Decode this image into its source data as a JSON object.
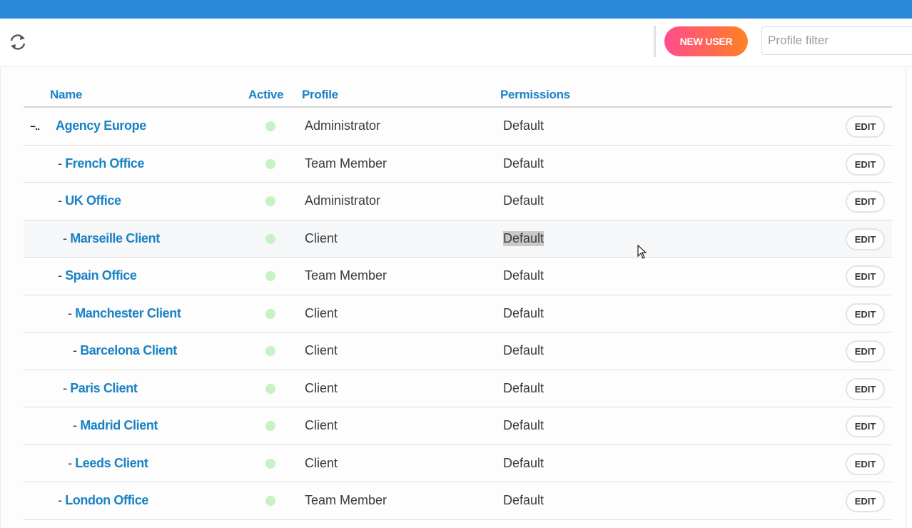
{
  "toolbar": {
    "refresh_icon": "refresh-icon",
    "new_user_label": "NEW USER",
    "filter_placeholder": "Profile filter",
    "filter_value": ""
  },
  "table": {
    "headers": {
      "name": "Name",
      "active": "Active",
      "profile": "Profile",
      "permissions": "Permissions"
    },
    "edit_label": "EDIT",
    "rows": [
      {
        "prefix": "",
        "name": "Agency Europe",
        "profile": "Administrator",
        "permissions": "Default",
        "active": true,
        "collapse": "−.."
      },
      {
        "prefix": "- ",
        "name": "French Office",
        "profile": "Team Member",
        "permissions": "Default",
        "active": true
      },
      {
        "prefix": "- ",
        "name": "UK Office",
        "profile": "Administrator",
        "permissions": "Default",
        "active": true
      },
      {
        "prefix": "- ",
        "name": "Marseille Client",
        "profile": "Client",
        "permissions": "Default",
        "active": true
      },
      {
        "prefix": "- ",
        "name": "Spain Office",
        "profile": "Team Member",
        "permissions": "Default",
        "active": true
      },
      {
        "prefix": "- ",
        "name": "Manchester Client",
        "profile": "Client",
        "permissions": "Default",
        "active": true
      },
      {
        "prefix": "- ",
        "name": "Barcelona Client",
        "profile": "Client",
        "permissions": "Default",
        "active": true
      },
      {
        "prefix": "- ",
        "name": "Paris Client",
        "profile": "Client",
        "permissions": "Default",
        "active": true
      },
      {
        "prefix": "- ",
        "name": "Madrid Client",
        "profile": "Client",
        "permissions": "Default",
        "active": true
      },
      {
        "prefix": "- ",
        "name": "Leeds Client",
        "profile": "Client",
        "permissions": "Default",
        "active": true
      },
      {
        "prefix": "- ",
        "name": "London Office",
        "profile": "Team Member",
        "permissions": "Default",
        "active": true
      }
    ]
  },
  "colors": {
    "topbar": "#2a8ad9",
    "link": "#1a82c4",
    "active_dot": "#c6f2c6",
    "button_gradient_start": "#ff4d8d",
    "button_gradient_end": "#ff8324"
  }
}
